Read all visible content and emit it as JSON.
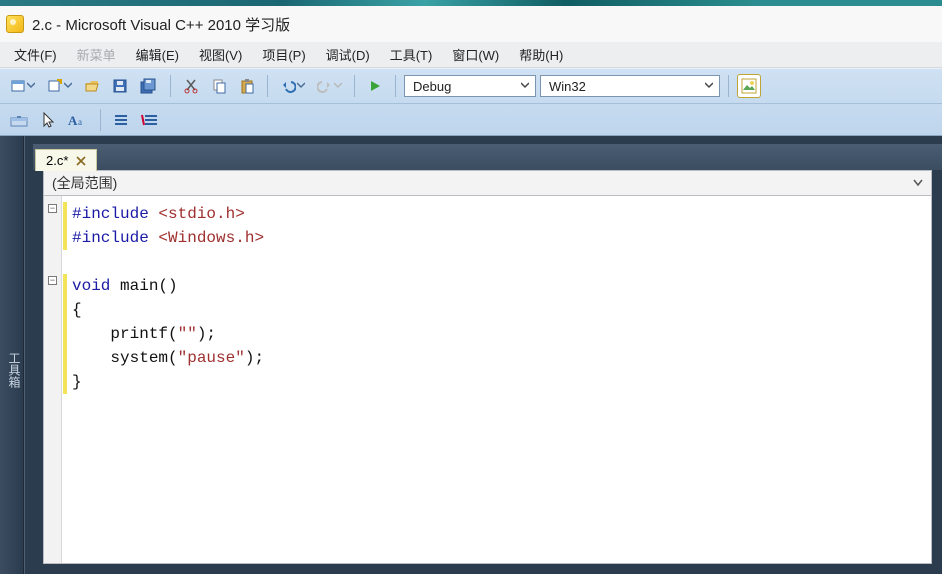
{
  "title": "2.c - Microsoft Visual C++ 2010 学习版",
  "menu": {
    "file": "文件(F)",
    "newmenu": "新菜单",
    "edit": "编辑(E)",
    "view": "视图(V)",
    "project": "项目(P)",
    "debug": "调试(D)",
    "tools": "工具(T)",
    "window": "窗口(W)",
    "help": "帮助(H)"
  },
  "toolbar1": {
    "config": "Debug",
    "platform": "Win32"
  },
  "left_panel_label": "工具箱",
  "doc_tab": {
    "label": "2.c*"
  },
  "scope": "(全局范围)",
  "code": {
    "l1_a": "#include ",
    "l1_b": "<stdio.h>",
    "l2_a": "#include ",
    "l2_b": "<Windows.h>",
    "l3": "",
    "l4_a": "void",
    "l4_b": " main()",
    "l5": "{",
    "l6_a": "    printf(",
    "l6_b": "\"\"",
    "l6_c": ");",
    "l7_a": "    system(",
    "l7_b": "\"pause\"",
    "l7_c": ");",
    "l8": "}"
  }
}
